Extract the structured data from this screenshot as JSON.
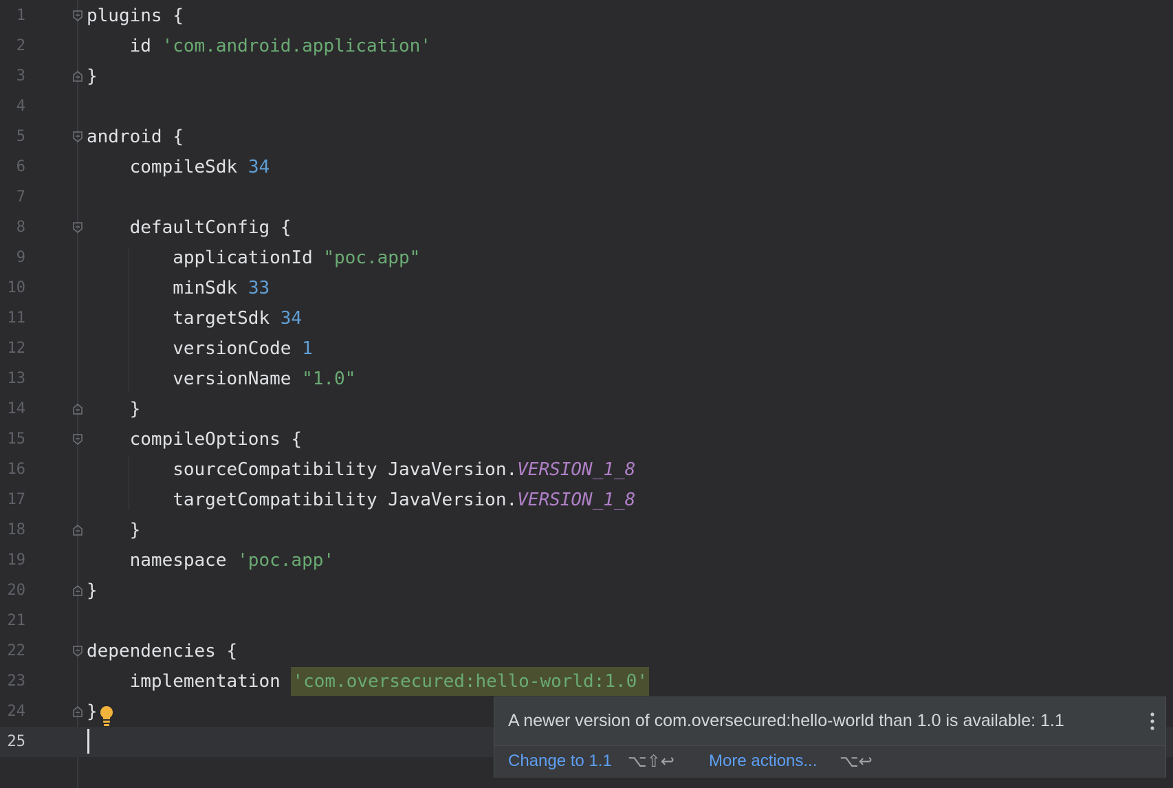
{
  "editor": {
    "line_numbers": [
      "1",
      "2",
      "3",
      "4",
      "5",
      "6",
      "7",
      "8",
      "9",
      "10",
      "11",
      "12",
      "13",
      "14",
      "15",
      "16",
      "17",
      "18",
      "19",
      "20",
      "21",
      "22",
      "23",
      "24",
      "25"
    ],
    "current_line": "25",
    "code": {
      "l1": {
        "t0": "plugins {"
      },
      "l2": {
        "t0": "    id ",
        "t1": "'com.android.application'"
      },
      "l3": {
        "t0": "}"
      },
      "l5": {
        "t0": "android {"
      },
      "l6": {
        "t0": "    compileSdk ",
        "t1": "34"
      },
      "l8": {
        "t0": "    defaultConfig {"
      },
      "l9": {
        "t0": "        applicationId ",
        "t1": "\"poc.app\""
      },
      "l10": {
        "t0": "        minSdk ",
        "t1": "33"
      },
      "l11": {
        "t0": "        targetSdk ",
        "t1": "34"
      },
      "l12": {
        "t0": "        versionCode ",
        "t1": "1"
      },
      "l13": {
        "t0": "        versionName ",
        "t1": "\"1.0\""
      },
      "l14": {
        "t0": "    }"
      },
      "l15": {
        "t0": "    compileOptions {"
      },
      "l16": {
        "t0": "        sourceCompatibility JavaVersion.",
        "t1": "VERSION_1_8"
      },
      "l17": {
        "t0": "        targetCompatibility JavaVersion.",
        "t1": "VERSION_1_8"
      },
      "l18": {
        "t0": "    }"
      },
      "l19": {
        "t0": "    namespace ",
        "t1": "'poc.app'"
      },
      "l20": {
        "t0": "}"
      },
      "l22": {
        "t0": "dependencies {"
      },
      "l23": {
        "t0": "    implementation ",
        "t1": "'com.oversecured:hello-world:1.0'"
      },
      "l24": {
        "t0": "}"
      }
    }
  },
  "popup": {
    "message": "A newer version of com.oversecured:hello-world than 1.0 is available: 1.1",
    "primary_action": "Change to 1.1",
    "primary_shortcut": "⌥⇧↩",
    "secondary_action": "More actions...",
    "secondary_shortcut": "⌥↩",
    "more_icon": "vertical-ellipsis-icon"
  },
  "colors": {
    "background": "#2b2b2d",
    "string": "#6aab73",
    "number": "#5f9fd6",
    "constant": "#b07fc7",
    "link": "#5e9ff5",
    "bulb": "#f2b33d"
  }
}
